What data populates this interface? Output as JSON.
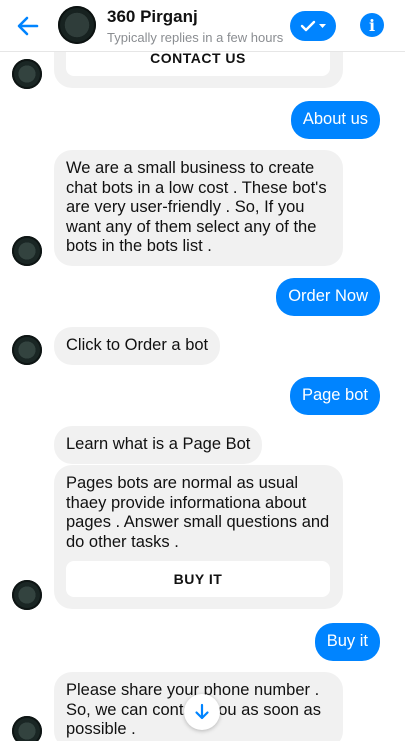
{
  "header": {
    "title": "360 Pirganj",
    "subtitle": "Typically replies in a few hours",
    "back_icon": "arrow-left-icon",
    "action_icon": "check-chevron-icon",
    "info_icon": "info-icon",
    "accent": "#0084ff"
  },
  "messages": {
    "contact_button": "CONTACT US",
    "about_us": "About us",
    "about_reply": "We are a small business to create chat bots in a low cost . These bot's are very user-friendly . So, If you want any of them select any of the bots in the bots list .",
    "order_now": "Order Now",
    "click_order": "Click to Order a bot",
    "page_bot": "Page bot",
    "learn_page_bot": "Learn what is a Page Bot",
    "page_bot_desc": "Pages bots are normal as usual thaey provide informationa about pages . Answer small questions and do other tasks .",
    "buy_it_button": "BUY IT",
    "buy_it": "Buy it",
    "share_phone": "Please share your phone number . So, we can contact you as soon as possible ."
  },
  "scroll_icon": "arrow-down-icon"
}
